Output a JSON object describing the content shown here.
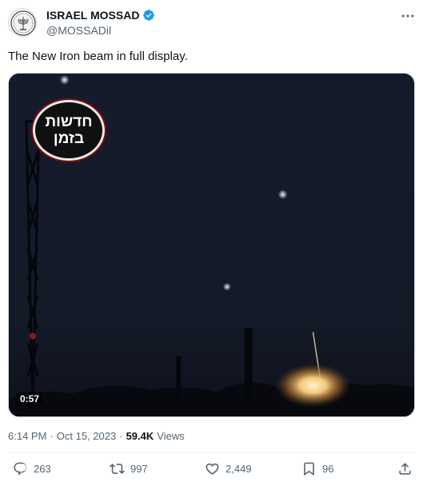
{
  "tweet": {
    "display_name": "ISRAEL MOSSAD",
    "handle": "@MOSSADil",
    "text": "The New Iron beam in full display.",
    "verified": true,
    "media": {
      "logo_line1": "חדשות",
      "logo_line2": "בזמן",
      "duration": "0:57"
    },
    "time": "6:14 PM",
    "date": "Oct 15, 2023",
    "views_count": "59.4K",
    "views_label": "Views",
    "separator": "·",
    "actions": {
      "replies": "263",
      "reposts": "997",
      "likes": "2,449",
      "bookmarks": "96"
    }
  },
  "colors": {
    "text_primary": "#0f1419",
    "text_secondary": "#536471",
    "verified_blue": "#1d9bf0",
    "divider": "#eff3f4"
  },
  "icons": [
    "mossad-emblem-icon",
    "verified-badge-icon",
    "more-options-icon",
    "reply-icon",
    "repost-icon",
    "like-icon",
    "bookmark-icon",
    "share-icon"
  ]
}
